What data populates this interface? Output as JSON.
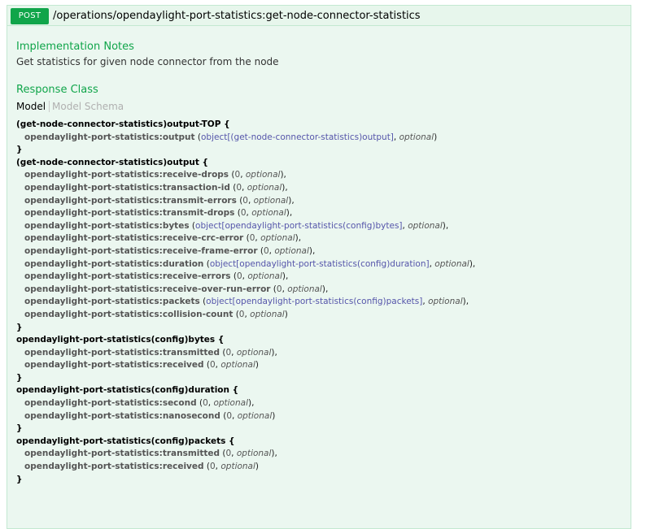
{
  "operation": {
    "method": "POST",
    "path": "/operations/opendaylight-port-statistics:get-node-connector-statistics"
  },
  "implementation_notes": {
    "title": "Implementation Notes",
    "text": "Get statistics for given node connector from the node"
  },
  "response_class": {
    "title": "Response Class",
    "tab_model": "Model",
    "tab_schema": "Model Schema"
  },
  "models": [
    {
      "name": "(get-node-connector-statistics)output-TOP {",
      "close": "}",
      "props": [
        {
          "name": "opendaylight-port-statistics:output",
          "type": "object[(get-node-connector-statistics)output]",
          "opt": "optional",
          "end": ")"
        }
      ]
    },
    {
      "name": "(get-node-connector-statistics)output {",
      "close": "}",
      "props": [
        {
          "name": "opendaylight-port-statistics:receive-drops",
          "type": "0",
          "opt": "optional",
          "end": "),"
        },
        {
          "name": "opendaylight-port-statistics:transaction-id",
          "type": "0",
          "opt": "optional",
          "end": "),"
        },
        {
          "name": "opendaylight-port-statistics:transmit-errors",
          "type": "0",
          "opt": "optional",
          "end": "),"
        },
        {
          "name": "opendaylight-port-statistics:transmit-drops",
          "type": "0",
          "opt": "optional",
          "end": "),"
        },
        {
          "name": "opendaylight-port-statistics:bytes",
          "type": "object[opendaylight-port-statistics(config)bytes]",
          "opt": "optional",
          "end": "),"
        },
        {
          "name": "opendaylight-port-statistics:receive-crc-error",
          "type": "0",
          "opt": "optional",
          "end": "),"
        },
        {
          "name": "opendaylight-port-statistics:receive-frame-error",
          "type": "0",
          "opt": "optional",
          "end": "),"
        },
        {
          "name": "opendaylight-port-statistics:duration",
          "type": "object[opendaylight-port-statistics(config)duration]",
          "opt": "optional",
          "end": "),"
        },
        {
          "name": "opendaylight-port-statistics:receive-errors",
          "type": "0",
          "opt": "optional",
          "end": "),"
        },
        {
          "name": "opendaylight-port-statistics:receive-over-run-error",
          "type": "0",
          "opt": "optional",
          "end": "),"
        },
        {
          "name": "opendaylight-port-statistics:packets",
          "type": "object[opendaylight-port-statistics(config)packets]",
          "opt": "optional",
          "end": "),"
        },
        {
          "name": "opendaylight-port-statistics:collision-count",
          "type": "0",
          "opt": "optional",
          "end": ")"
        }
      ]
    },
    {
      "name": "opendaylight-port-statistics(config)bytes {",
      "close": "}",
      "props": [
        {
          "name": "opendaylight-port-statistics:transmitted",
          "type": "0",
          "opt": "optional",
          "end": "),"
        },
        {
          "name": "opendaylight-port-statistics:received",
          "type": "0",
          "opt": "optional",
          "end": ")"
        }
      ]
    },
    {
      "name": "opendaylight-port-statistics(config)duration {",
      "close": "}",
      "props": [
        {
          "name": "opendaylight-port-statistics:second",
          "type": "0",
          "opt": "optional",
          "end": "),"
        },
        {
          "name": "opendaylight-port-statistics:nanosecond",
          "type": "0",
          "opt": "optional",
          "end": ")"
        }
      ]
    },
    {
      "name": "opendaylight-port-statistics(config)packets {",
      "close": "}",
      "props": [
        {
          "name": "opendaylight-port-statistics:transmitted",
          "type": "0",
          "opt": "optional",
          "end": "),"
        },
        {
          "name": "opendaylight-port-statistics:received",
          "type": "0",
          "opt": "optional",
          "end": ")"
        }
      ]
    }
  ]
}
